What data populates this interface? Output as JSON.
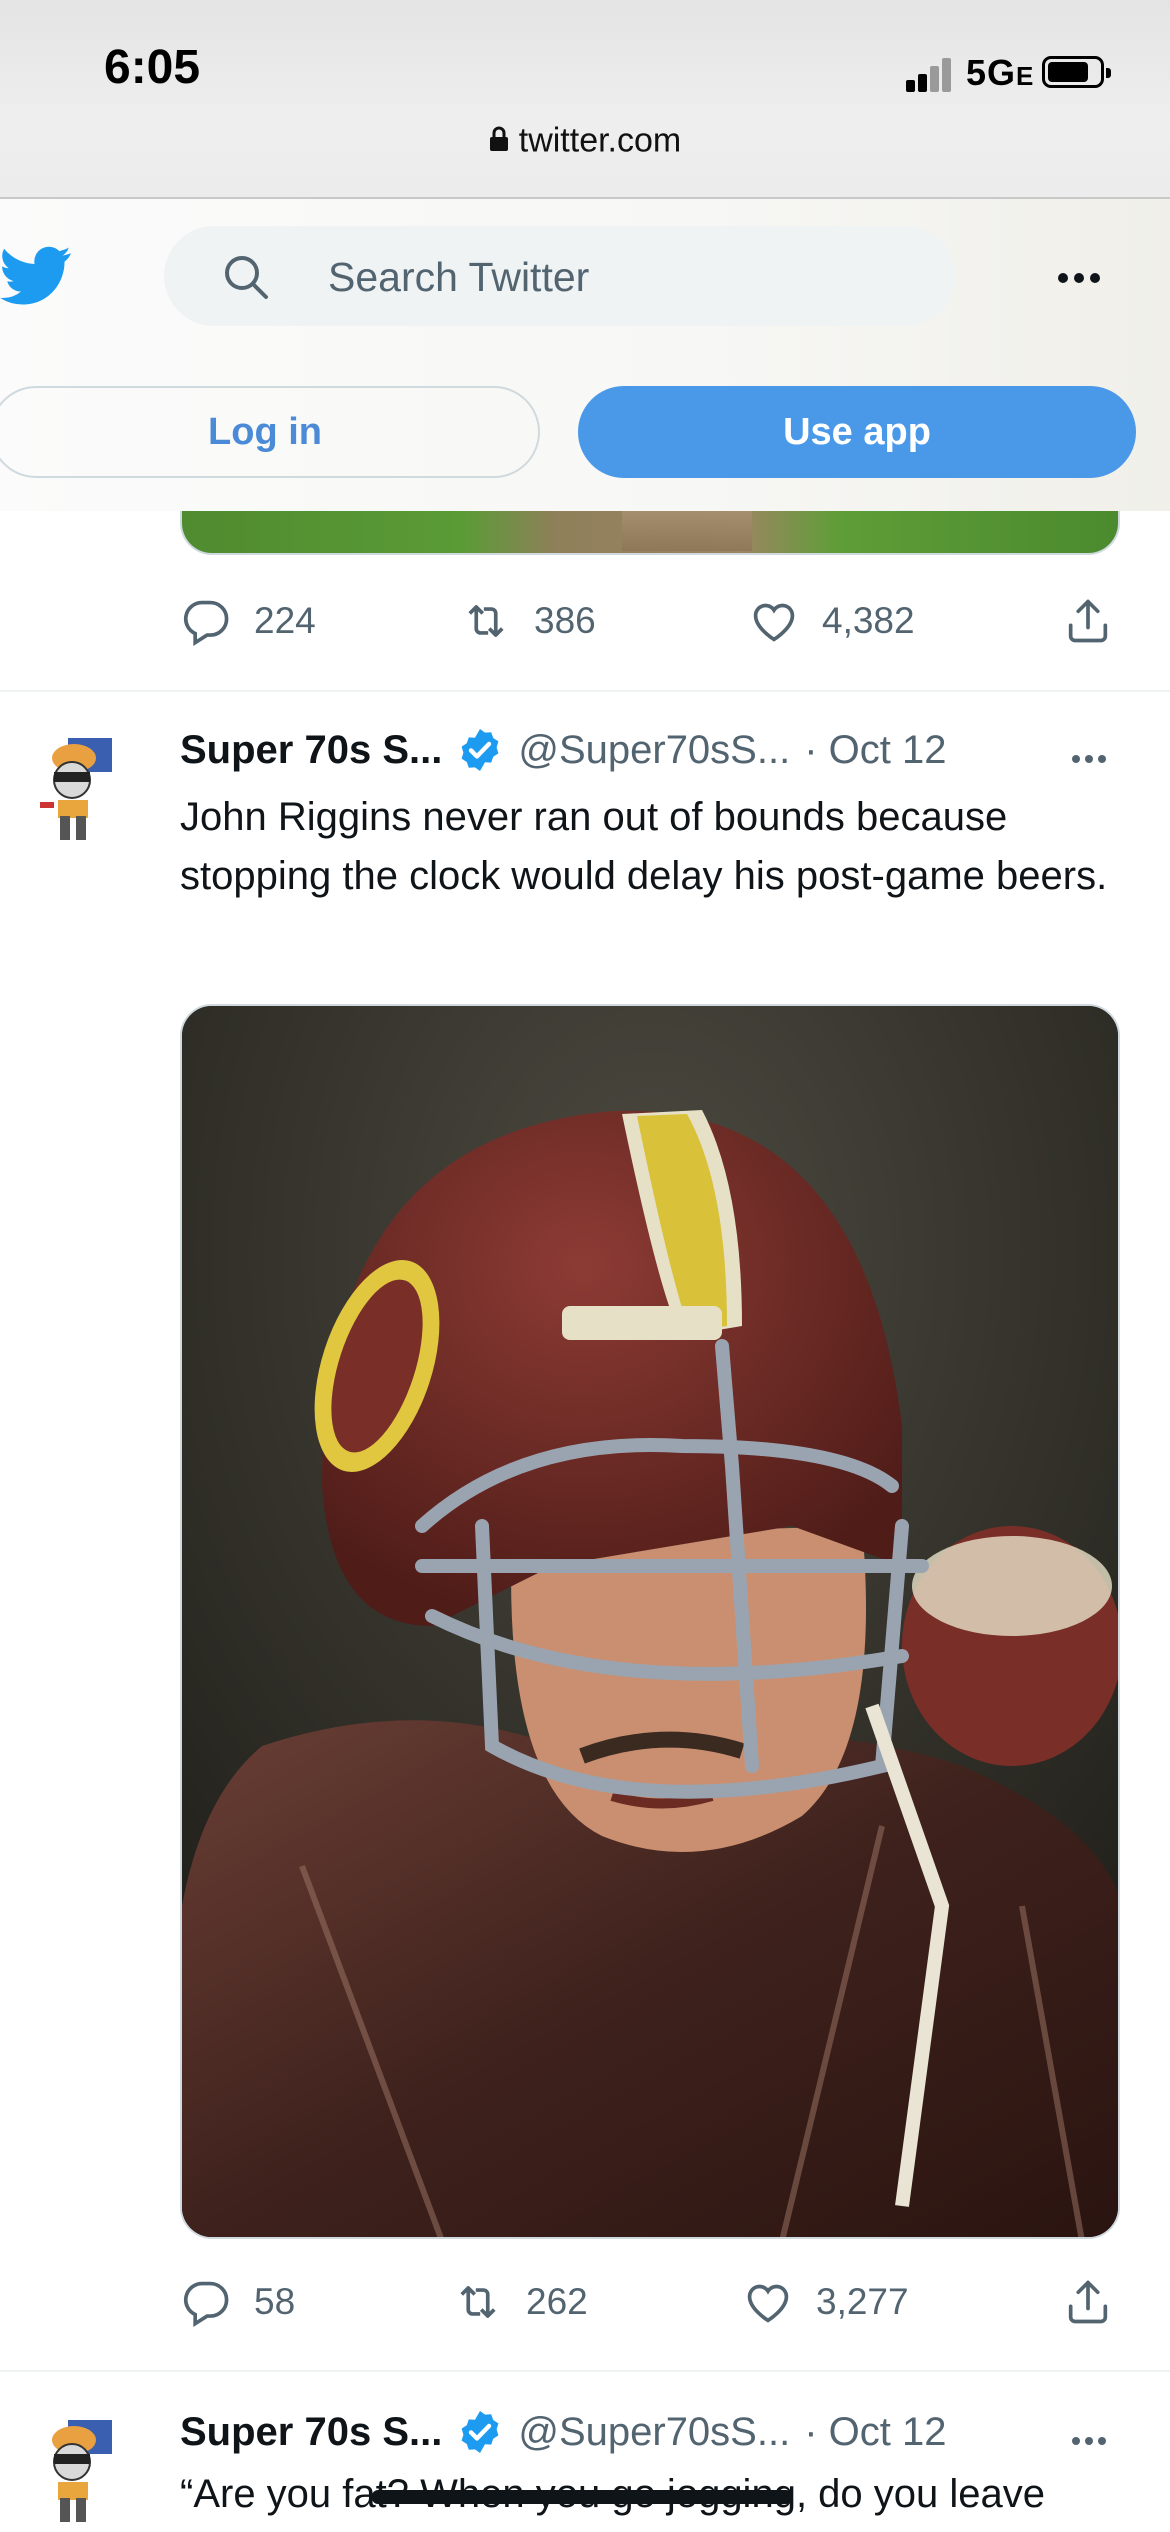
{
  "status_bar": {
    "time": "6:05",
    "network": "5G",
    "network_suffix": "E"
  },
  "browser": {
    "url": "twitter.com"
  },
  "header": {
    "search_placeholder": "Search Twitter",
    "login_label": "Log in",
    "use_app_label": "Use app"
  },
  "prev_tweet": {
    "replies": "224",
    "retweets": "386",
    "likes": "4,382"
  },
  "tweet1": {
    "name": "Super 70s S...",
    "handle": "@Super70sS...",
    "date": "· Oct 12",
    "text": "John Riggins never ran out of bounds because stopping the clock would delay his post-game beers.",
    "replies": "58",
    "retweets": "262",
    "likes": "3,277"
  },
  "tweet2": {
    "name": "Super 70s S...",
    "handle": "@Super70sS...",
    "date": "· Oct 12",
    "text_visible": "“Are you fat? When you go jogging, do you leave"
  },
  "colors": {
    "twitter_blue": "#1d9bf0",
    "use_app_bg": "#4a98e8",
    "secondary_text": "#536471",
    "primary_text": "#0f1419"
  }
}
